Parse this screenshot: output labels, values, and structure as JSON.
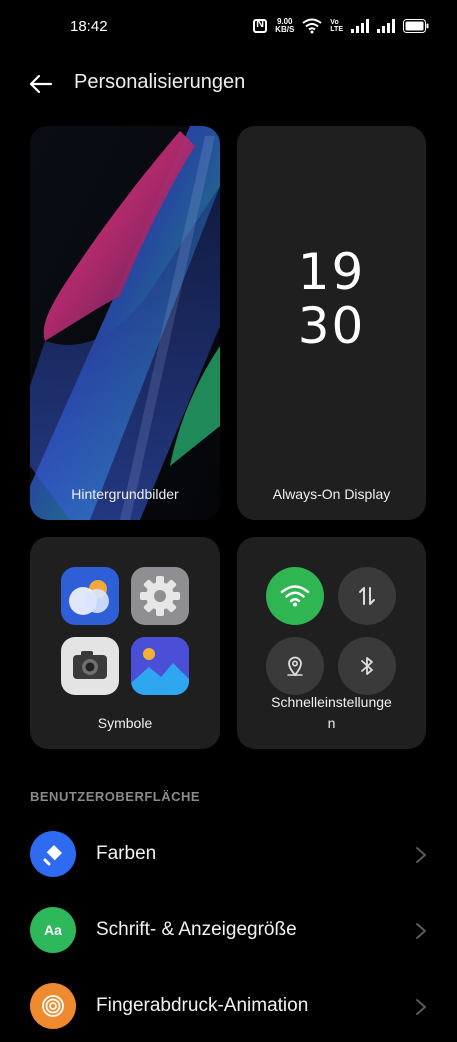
{
  "status_bar": {
    "time": "18:42",
    "speed_value": "9.00",
    "speed_unit": "KB/S",
    "volte_top": "Vo",
    "volte_bottom": "LTE"
  },
  "header": {
    "title": "Personalisierungen"
  },
  "cards": {
    "wallpaper_label": "Hintergrundbilder",
    "aod_label": "Always-On Display",
    "aod_hour": "19",
    "aod_minute": "30",
    "icons_label": "Symbole",
    "quick_label_line1": "Schnelleinstellunge",
    "quick_label_line2": "n"
  },
  "section": {
    "title": "BENUTZEROBERFLÄCHE"
  },
  "list": {
    "items": [
      {
        "label": "Farben",
        "icon": "paint-bucket-icon",
        "color": "#2f6bf0"
      },
      {
        "label": "Schrift- & Anzeigegröße",
        "icon": "font-size-icon",
        "color": "#2eb85c",
        "icon_text": "Aa"
      },
      {
        "label": "Fingerabdruck-Animation",
        "icon": "fingerprint-icon",
        "color": "#f08a2e"
      }
    ]
  },
  "colors": {
    "background": "#000000",
    "card": "#1f1f1f",
    "wifi_active": "#2fb552",
    "qs_inactive": "#3a3a3a"
  }
}
